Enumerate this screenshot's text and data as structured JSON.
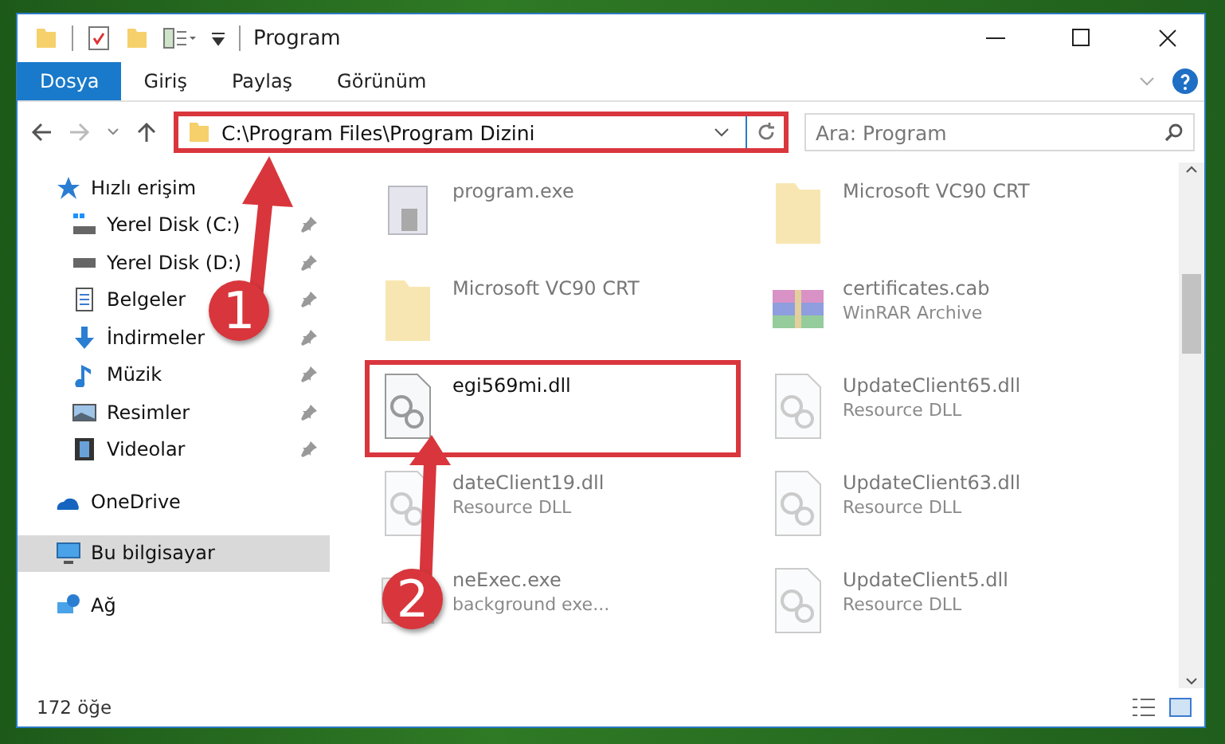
{
  "window": {
    "title": "Program"
  },
  "ribbon": {
    "tabs": [
      {
        "label": "Dosya",
        "selected": true
      },
      {
        "label": "Giriş",
        "selected": false
      },
      {
        "label": "Paylaş",
        "selected": false
      },
      {
        "label": "Görünüm",
        "selected": false
      }
    ]
  },
  "address": {
    "path": "C:\\Program Files\\Program Dizini",
    "highlighted": true
  },
  "search": {
    "placeholder": "Ara: Program"
  },
  "sidebar": {
    "items": [
      {
        "label": "Hızlı erişim",
        "selected": false,
        "children": [
          {
            "label": "Yerel Disk (C:)",
            "pinned": true,
            "selected": false
          },
          {
            "label": "Yerel Disk (D:)",
            "pinned": true,
            "selected": false
          },
          {
            "label": "Belgeler",
            "pinned": true,
            "selected": false
          },
          {
            "label": "İndirmeler",
            "pinned": true,
            "selected": false
          },
          {
            "label": "Müzik",
            "pinned": true,
            "selected": false
          },
          {
            "label": "Resimler",
            "pinned": true,
            "selected": false
          },
          {
            "label": "Videolar",
            "pinned": true,
            "selected": false
          }
        ]
      },
      {
        "label": "OneDrive",
        "selected": false
      },
      {
        "label": "Bu bilgisayar",
        "selected": true
      },
      {
        "label": "Ağ",
        "selected": false
      }
    ]
  },
  "files": [
    {
      "name": "program.exe",
      "kind": "app",
      "blurred": true,
      "highlighted": false
    },
    {
      "name": "Microsoft VC90 CRT",
      "kind": "folder",
      "blurred": true,
      "highlighted": false
    },
    {
      "name": "Microsoft VC90 CRT",
      "kind": "folder",
      "blurred": true,
      "highlighted": false
    },
    {
      "name": "certificates.cab",
      "type": "WinRAR Archive",
      "kind": "archive",
      "blurred": true,
      "highlighted": false
    },
    {
      "name": "egi569mi.dll",
      "kind": "dll",
      "blurred": false,
      "highlighted": true
    },
    {
      "name": "UpdateClient65.dll",
      "type": "Resource DLL",
      "kind": "dll",
      "blurred": true,
      "highlighted": false
    },
    {
      "name": "dateClient19.dll",
      "type": "Resource DLL",
      "kind": "dll",
      "blurred": true,
      "highlighted": false
    },
    {
      "name": "UpdateClient63.dll",
      "type": "Resource DLL",
      "kind": "dll",
      "blurred": true,
      "highlighted": false
    },
    {
      "name": "neExec.exe",
      "type": "background exe...",
      "kind": "exe",
      "blurred": true,
      "highlighted": false
    },
    {
      "name": "UpdateClient5.dll",
      "type": "Resource DLL",
      "kind": "dll",
      "blurred": true,
      "highlighted": false
    }
  ],
  "status_bar": {
    "count": "172 öğe"
  },
  "annotations": [
    {
      "number": "1"
    },
    {
      "number": "2"
    }
  ]
}
